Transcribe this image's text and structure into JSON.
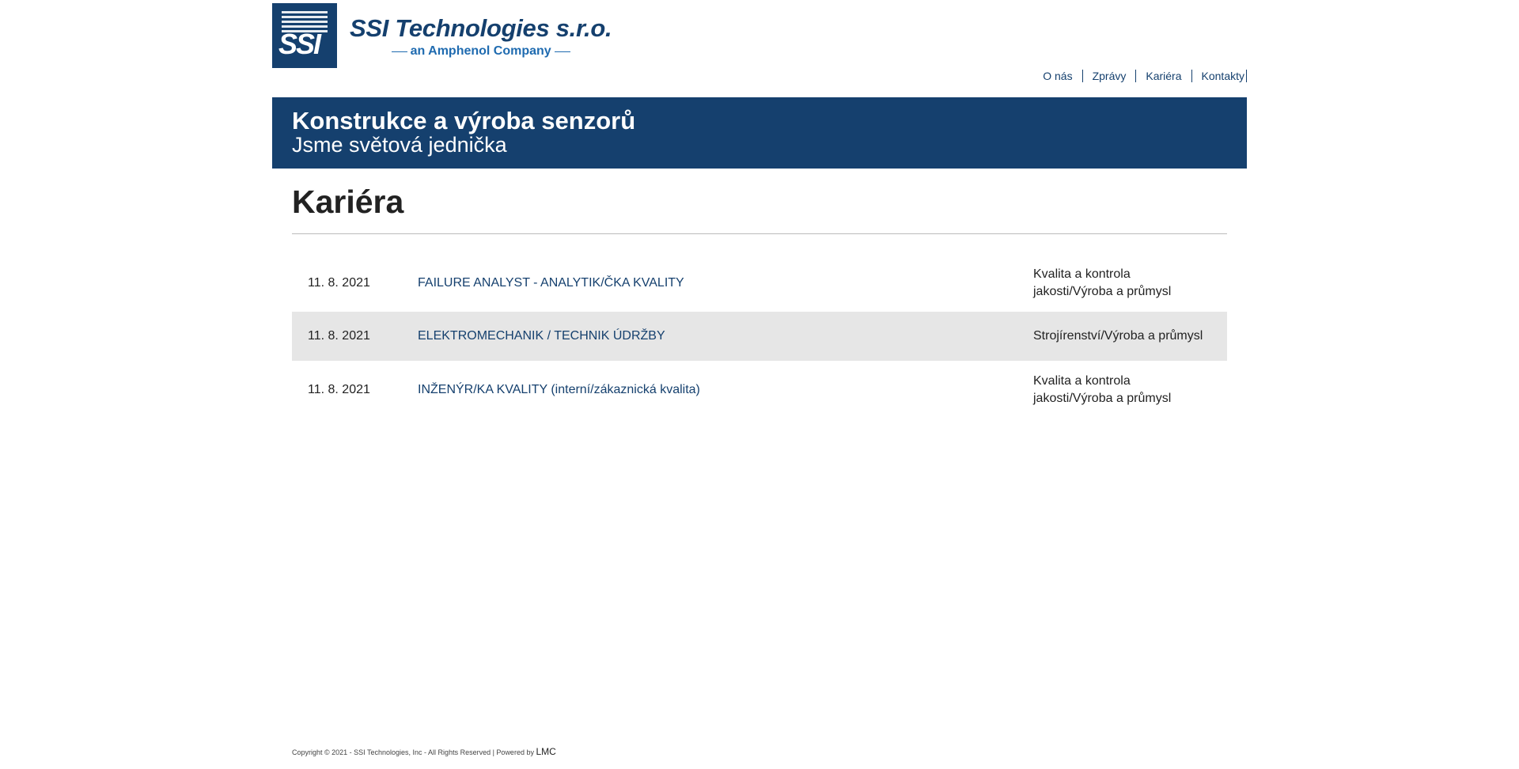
{
  "header": {
    "logo_mark_text": "SSI",
    "company_name": "SSI Technologies s.r.o.",
    "company_tagline": "an Amphenol Company"
  },
  "nav": {
    "items": [
      {
        "label": "O nás"
      },
      {
        "label": "Zprávy"
      },
      {
        "label": "Kariéra"
      },
      {
        "label": "Kontakty"
      }
    ]
  },
  "banner": {
    "title": "Konstrukce a výroba senzorů",
    "subtitle": "Jsme světová jednička"
  },
  "main": {
    "page_title": "Kariéra",
    "jobs": [
      {
        "date": "11. 8. 2021",
        "title": "FAILURE ANALYST - ANALYTIK/ČKA KVALITY",
        "category": "Kvalita a kontrola jakosti/Výroba a průmysl"
      },
      {
        "date": "11. 8. 2021",
        "title": "ELEKTROMECHANIK / TECHNIK ÚDRŽBY",
        "category": "Strojírenství/Výroba a průmysl"
      },
      {
        "date": "11. 8. 2021",
        "title": "INŽENÝR/KA KVALITY (interní/zákaznická kvalita)",
        "category": "Kvalita a kontrola jakosti/Výroba a průmysl"
      }
    ]
  },
  "footer": {
    "copyright": "Copyright © 2021 - SSI Technologies, Inc - All Rights Reserved | Powered by ",
    "powered_by": "LMC"
  },
  "colors": {
    "brand_navy": "#15406e",
    "brand_blue": "#1f6bb0",
    "row_alt": "#e6e6e6"
  }
}
